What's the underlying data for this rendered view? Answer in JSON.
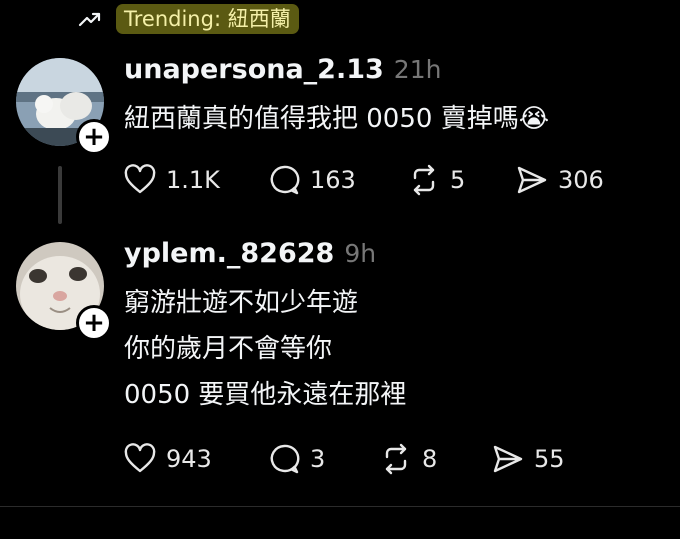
{
  "trending": {
    "label": "Trending: 紐西蘭",
    "icon": "trending-arrow-icon"
  },
  "posts": [
    {
      "username": "unapersona_2.13",
      "time": "21h",
      "lines": [
        "紐西蘭真的值得我把 0050 賣掉嗎😭"
      ],
      "likes": "1.1K",
      "comments": "163",
      "reposts": "5",
      "shares": "306"
    },
    {
      "username": "yplem._82628",
      "time": "9h",
      "lines": [
        "窮游壯遊不如少年遊",
        "你的歲月不會等你",
        "0050 要買他永遠在那裡"
      ],
      "likes": "943",
      "comments": "3",
      "reposts": "8",
      "shares": "55"
    }
  ],
  "colors": {
    "background": "#000000",
    "trending_pill": "#5b5a12",
    "trending_text": "#f4f0a8",
    "muted": "#777777"
  }
}
